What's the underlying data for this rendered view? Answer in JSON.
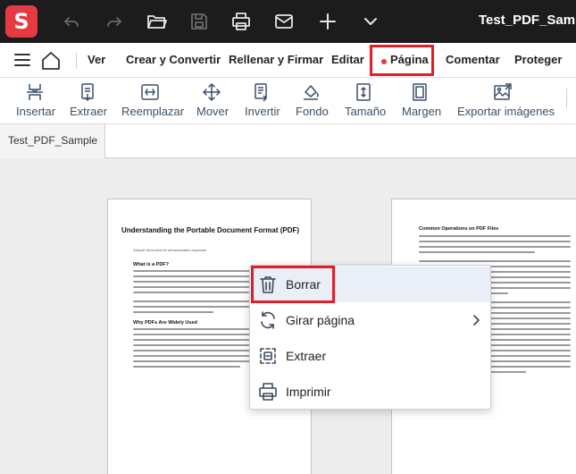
{
  "app": {
    "logo_letter": "S",
    "document_title": "Test_PDF_Sample"
  },
  "menu": {
    "items": [
      "Ver",
      "Crear y Convertir",
      "Rellenar y Firmar",
      "Editar",
      "Página",
      "Comentar",
      "Proteger"
    ],
    "active": "Página"
  },
  "toolbar": {
    "tools": [
      {
        "label": "Insertar",
        "icon": "insert-page-icon"
      },
      {
        "label": "Extraer",
        "icon": "extract-page-icon"
      },
      {
        "label": "Reemplazar",
        "icon": "replace-page-icon"
      },
      {
        "label": "Mover",
        "icon": "move-icon"
      },
      {
        "label": "Invertir",
        "icon": "reverse-icon"
      },
      {
        "label": "Fondo",
        "icon": "background-fill-icon"
      },
      {
        "label": "Tamaño",
        "icon": "page-size-icon"
      },
      {
        "label": "Margen",
        "icon": "margin-icon"
      },
      {
        "label": "Exportar imágenes",
        "icon": "export-images-icon"
      }
    ]
  },
  "tab": {
    "label": "Test_PDF_Sample"
  },
  "page1": {
    "title": "Understanding the Portable Document Format (PDF)",
    "subtitle": "Sample document for demonstration purposes",
    "h1": "What is a PDF?",
    "h2": "Why PDFs Are Widely Used"
  },
  "page2": {
    "h1": "Common Operations on PDF Files"
  },
  "context_menu": {
    "items": [
      {
        "label": "Borrar",
        "icon": "trash-icon",
        "highlighted": true
      },
      {
        "label": "Girar página",
        "icon": "rotate-icon",
        "submenu": true
      },
      {
        "label": "Extraer",
        "icon": "extract-icon"
      },
      {
        "label": "Imprimir",
        "icon": "print-icon"
      }
    ]
  },
  "colors": {
    "accent": "#e53a44",
    "highlight_border": "#e31c26",
    "toolbar_text": "#3a5069",
    "titlebar": "#1c1c1c"
  }
}
